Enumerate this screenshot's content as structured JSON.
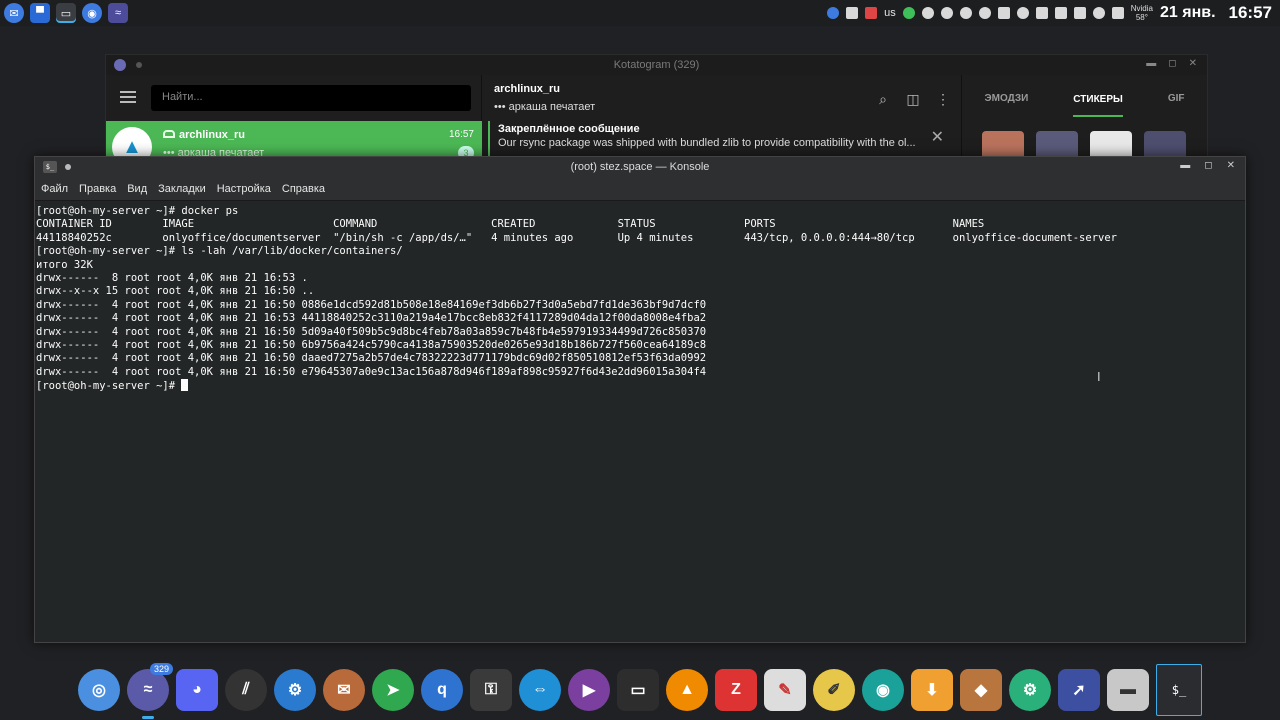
{
  "toppanel": {
    "layout": "us",
    "gpu_label": "Nvidia",
    "gpu_temp": "58°",
    "date": "21 янв.",
    "time": "16:57"
  },
  "telegram": {
    "title": "Kotatogram (329)",
    "search_placeholder": "Найти...",
    "chat": {
      "name": "archlinux_ru",
      "time": "16:57",
      "typing": "••• аркаша печатает",
      "badge": "3"
    },
    "header": {
      "name": "archlinux_ru",
      "typing": "••• аркаша печатает"
    },
    "pinned": {
      "title": "Закреплённое сообщение",
      "text": "Our rsync package was shipped with bundled zlib to provide compatibility with the ol..."
    },
    "tabs": [
      "ЭМОДЗИ",
      "СТИКЕРЫ",
      "GIF"
    ]
  },
  "konsole": {
    "title": "(root) stez.space — Konsole",
    "menu": [
      "Файл",
      "Правка",
      "Вид",
      "Закладки",
      "Настройка",
      "Справка"
    ],
    "lines": [
      "[root@oh-my-server ~]# docker ps",
      "CONTAINER ID        IMAGE                      COMMAND                  CREATED             STATUS              PORTS                            NAMES",
      "44118840252c        onlyoffice/documentserver  \"/bin/sh -c /app/ds/…\"   4 minutes ago       Up 4 minutes        443/tcp, 0.0.0.0:444→80/tcp      onlyoffice-document-server",
      "[root@oh-my-server ~]# ls -lah /var/lib/docker/containers/",
      "итого 32K",
      "drwx------  8 root root 4,0K янв 21 16:53 .",
      "drwx--x--x 15 root root 4,0K янв 21 16:50 ..",
      "drwx------  4 root root 4,0K янв 21 16:50 0886e1dcd592d81b508e18e84169ef3db6b27f3d0a5ebd7fd1de363bf9d7dcf0",
      "drwx------  4 root root 4,0K янв 21 16:53 44118840252c3110a219a4e17bcc8eb832f4117289d04da12f00da8008e4fba2",
      "drwx------  4 root root 4,0K янв 21 16:50 5d09a40f509b5c9d8bc4feb78a03a859c7b48fb4e597919334499d726c850370",
      "drwx------  4 root root 4,0K янв 21 16:50 6b9756a424c5790ca4138a75903520de0265e93d18b186b727f560cea64189c8",
      "drwx------  4 root root 4,0K янв 21 16:50 daaed7275a2b57de4c78322223d771179bdc69d02f850510812ef53f63da0992",
      "drwx------  4 root root 4,0K янв 21 16:50 e79645307a0e9c13ac156a878d946f189af898c95927f6d43e2dd96015a304f4"
    ],
    "prompt": "[root@oh-my-server ~]# "
  },
  "dock": {
    "telegram_badge": "329",
    "terminal_label": "$_"
  }
}
